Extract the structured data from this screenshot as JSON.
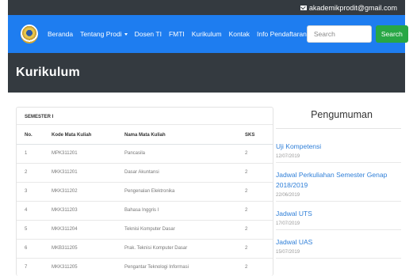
{
  "topbar": {
    "email": "akademikprodit@gmail.com",
    "email_icon": "envelope-icon"
  },
  "navbar": {
    "logo": "university-seal-logo",
    "items": [
      {
        "label": "Beranda"
      },
      {
        "label": "Tentang Prodi",
        "dropdown": true
      },
      {
        "label": "Dosen TI"
      },
      {
        "label": "FMTI"
      },
      {
        "label": "Kurikulum"
      },
      {
        "label": "Kontak"
      },
      {
        "label": "Info Pendaftaran"
      }
    ],
    "search": {
      "placeholder": "Search",
      "button_label": "Search"
    }
  },
  "page_header": {
    "title": "Kurikulum"
  },
  "curriculum": {
    "semester_label": "SEMESTER I",
    "columns": [
      "No.",
      "Kode Mata Kuliah",
      "Nama Mata Kuliah",
      "SKS"
    ],
    "rows": [
      [
        "1",
        "MPK311201",
        "Pancasila",
        "2"
      ],
      [
        "2",
        "MKK311201",
        "Dasar Akuntansi",
        "2"
      ],
      [
        "3",
        "MKK311202",
        "Pengenalan Elektronika",
        "2"
      ],
      [
        "4",
        "MKK311203",
        "Bahasa Inggris I",
        "2"
      ],
      [
        "5",
        "MKK311204",
        "Teknisi Komputer Dasar",
        "2"
      ],
      [
        "6",
        "MKB311205",
        "Prak. Teknisi Komputer Dasar",
        "2"
      ],
      [
        "7",
        "MKK311205",
        "Pengantar Teknologi Informasi",
        "2"
      ]
    ]
  },
  "announcements": {
    "heading": "Pengumuman",
    "items": [
      {
        "title": "Uji Kompetensi",
        "date": "12/07/2019"
      },
      {
        "title": "Jadwal Perkuliahan Semester Genap 2018/2019",
        "date": "22/06/2019"
      },
      {
        "title": "Jadwal UTS",
        "date": "17/07/2019"
      },
      {
        "title": "Jadwal UAS",
        "date": "15/07/2019"
      }
    ]
  },
  "colors": {
    "topbar": "#343a40",
    "navbar": "#1e7df0",
    "search_button": "#28a745",
    "link": "#2f7fd8"
  }
}
